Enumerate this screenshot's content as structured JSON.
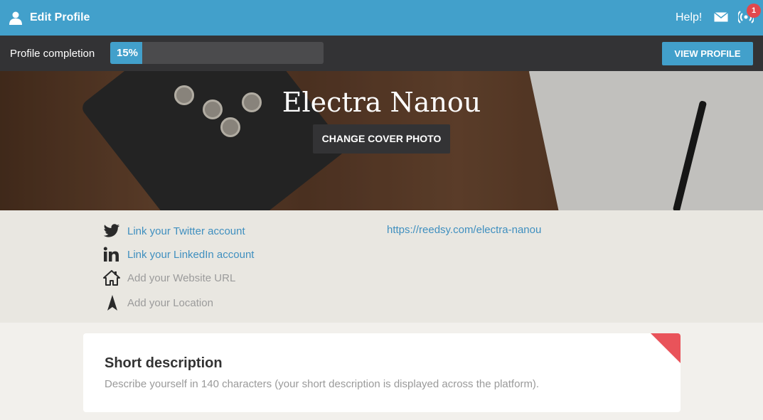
{
  "topbar": {
    "title": "Edit Profile",
    "help_label": "Help!",
    "notification_count": "1",
    "icons": [
      "user-icon",
      "mail-icon",
      "broadcast-icon"
    ]
  },
  "progress": {
    "label": "Profile completion",
    "value_text": "15%",
    "value_fraction": 0.15,
    "view_profile_label": "VIEW PROFILE"
  },
  "cover": {
    "name": "Electra Nanou",
    "change_cover_label": "CHANGE COVER PHOTO"
  },
  "links": {
    "twitter": "Link your Twitter account",
    "linkedin": "Link your LinkedIn account",
    "website": "Add your Website URL",
    "location": "Add your Location",
    "profile_url": "https://reedsy.com/electra-nanou"
  },
  "card": {
    "title": "Short description",
    "description": "Describe yourself in 140 characters (your short description is displayed across the platform)."
  },
  "colors": {
    "accent": "#42a0cb",
    "dark_bar": "#333335",
    "badge": "#e2484d",
    "link": "#3f8fbf",
    "corner": "#e9535a"
  }
}
